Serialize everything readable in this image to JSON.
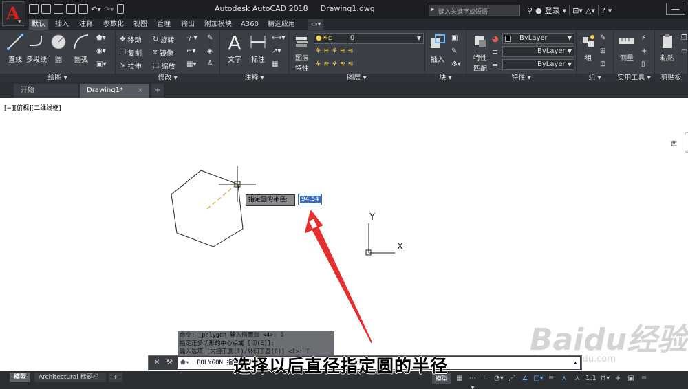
{
  "titlebar": {
    "app_name": "Autodesk AutoCAD 2018",
    "document": "Drawing1.dwg",
    "search_placeholder": "键入关键字或短语",
    "login": "登录",
    "help": "?"
  },
  "ribbon_tabs": [
    "默认",
    "插入",
    "注释",
    "参数化",
    "视图",
    "管理",
    "输出",
    "附加模块",
    "A360",
    "精选应用"
  ],
  "draw_panel": {
    "name": "绘图",
    "line": "直线",
    "polyline": "多段线",
    "circle": "圆",
    "arc": "圆弧"
  },
  "modify_panel": {
    "name": "修改",
    "move": "移动",
    "rotate": "旋转",
    "copy": "复制",
    "mirror": "镜像",
    "stretch": "拉伸",
    "scale": "缩放"
  },
  "annotation_panel": {
    "name": "注释",
    "text": "文字",
    "dimension": "标注"
  },
  "layers_panel": {
    "name": "图层",
    "layer_props_l1": "图层",
    "layer_props_l2": "特性",
    "current_layer": "0"
  },
  "block_panel": {
    "name": "块",
    "insert": "插入"
  },
  "properties_panel": {
    "name": "特性",
    "match_l1": "特性",
    "match_l2": "匹配",
    "color": "ByLayer",
    "linetype": "ByLayer",
    "lineweight": "ByLayer"
  },
  "groups_panel": {
    "name": "组",
    "group": "组"
  },
  "utilities_panel": {
    "name": "实用工具",
    "measure": "测量"
  },
  "clipboard_panel": {
    "name": "剪贴板",
    "paste": "粘贴"
  },
  "doc_tabs": {
    "start": "开始",
    "drawing": "Drawing1*"
  },
  "viewport_label": "[−][俯视][二维线框]",
  "dynamic_input": {
    "prompt": "指定圆的半径:",
    "value": "94.54"
  },
  "ucs": {
    "x": "X",
    "y": "Y"
  },
  "view_hint": "西",
  "command_history": [
    "命令:  _polygon 输入侧面数 <4>: 6",
    "指定正多切形的中心点或 [切(E)]:",
    "输入选项 [内接于圆(I)/外切于圆(C)] <I>: I"
  ],
  "command_line": "POLYGON 指定圆的半径:",
  "subtitle": "选择以后直径指定圆的半径",
  "layout_tabs": {
    "model": "模型",
    "layout": "Architectural 标题栏"
  },
  "statusbar": {
    "model": "模型",
    "scale": "1:1"
  },
  "watermark": {
    "logo": "Baidu经验",
    "url": "jingyan.baidu.com"
  }
}
